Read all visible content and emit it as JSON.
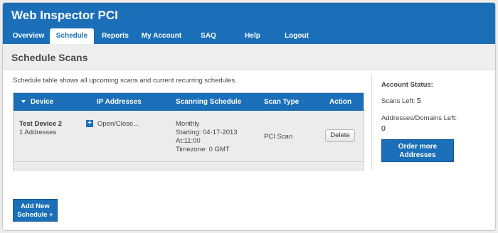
{
  "app": {
    "title": "Web Inspector PCI"
  },
  "nav": {
    "tabs": [
      {
        "label": "Overview"
      },
      {
        "label": "Schedule",
        "active": true
      },
      {
        "label": "Reports"
      },
      {
        "label": "My Account"
      },
      {
        "label": "SAQ"
      },
      {
        "label": "Help"
      },
      {
        "label": "Logout"
      }
    ]
  },
  "page": {
    "title": "Schedule Scans",
    "intro": "Schedule table shows all upcoming scans and current recurring schedules."
  },
  "table": {
    "headers": [
      "Device",
      "IP Addresses",
      "Scanning Schedule",
      "Scan Type",
      "Action"
    ],
    "rows": [
      {
        "device": "Test Device 2",
        "addresses": "1 Addresses",
        "ip_toggle": "Open/Close...",
        "schedule": [
          "Monthly",
          "Starting: 04-17-2013",
          "At:11:00",
          "Timezone: 0 GMT"
        ],
        "scan_type": "PCI Scan",
        "action": "Delete"
      }
    ]
  },
  "sidebar": {
    "status_label": "Account Status:",
    "scans_left_label": "Scans Left:",
    "scans_left_value": "5",
    "addresses_left_label": "Addresses/Domains Left:",
    "addresses_left_value": "0",
    "order_button": [
      "Order more",
      "Addresses"
    ]
  },
  "add_button": [
    "Add New",
    "Schedule +"
  ],
  "icons": {
    "sort": "sort-down-icon",
    "expand": "plus-icon"
  },
  "colors": {
    "brand": "#1a6fb8",
    "page_bg": "#eeeeee"
  }
}
